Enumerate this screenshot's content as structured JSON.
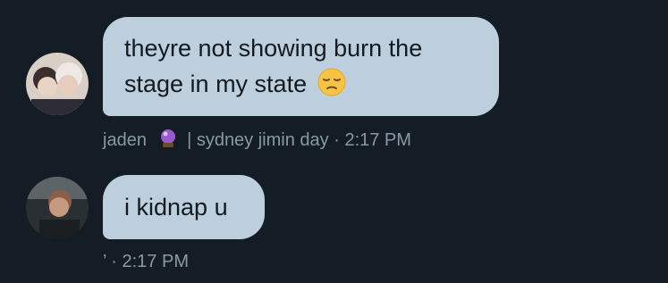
{
  "messages": [
    {
      "text_line1": "theyre not showing burn the",
      "text_line2": "stage in my state",
      "emoji": "pensive-face",
      "sender_name": "jaden",
      "sender_emoji": "crystal-ball",
      "sender_status": "| sydney jimin day",
      "separator": "·",
      "time": "2:17 PM"
    },
    {
      "text": "i kidnap u",
      "sender_name": "’",
      "separator": "·",
      "time": "2:17 PM"
    }
  ],
  "colors": {
    "background": "#141d26",
    "bubble": "#bdcfdc",
    "meta_text": "#8899a6"
  }
}
